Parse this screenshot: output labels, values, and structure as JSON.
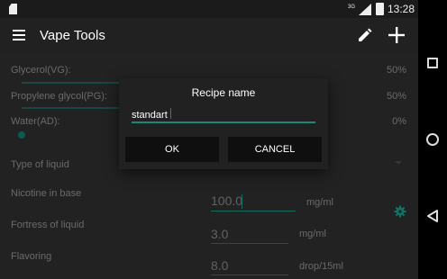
{
  "status_bar": {
    "network": "3G",
    "time": "13:28"
  },
  "app_bar": {
    "title": "Vape Tools",
    "menu_icon": "hamburger-menu-icon",
    "edit_icon": "pencil-icon",
    "add_icon": "plus-icon"
  },
  "form": {
    "glycerol": {
      "label": "Glycerol(VG):",
      "value": "50%",
      "level": 0.5
    },
    "propylene": {
      "label": "Propylene glycol(PG):",
      "value": "50%",
      "level": 0.5
    },
    "water": {
      "label": "Water(AD):",
      "value": "0%",
      "level": 0
    },
    "type_of_liquid": {
      "label": "Type of liquid"
    },
    "nicotine_base": {
      "label": "Nicotine in base",
      "value": "100.0",
      "unit": "mg/ml"
    },
    "fortress": {
      "label": "Fortress of liquid",
      "value": "3.0",
      "unit": "mg/ml"
    },
    "flavoring": {
      "label": "Flavoring",
      "value": "8.0",
      "unit": "drop/15ml",
      "icon": "gear-icon"
    }
  },
  "dialog": {
    "title": "Recipe name",
    "input_value": "standart",
    "ok_label": "OK",
    "cancel_label": "CANCEL"
  },
  "nav_bar": {
    "recents_icon": "square-recents-icon",
    "home_icon": "circle-home-icon",
    "back_icon": "triangle-back-icon"
  },
  "colors": {
    "accent": "#16897a",
    "background": "#2c2c2c",
    "dialog": "#212121"
  }
}
